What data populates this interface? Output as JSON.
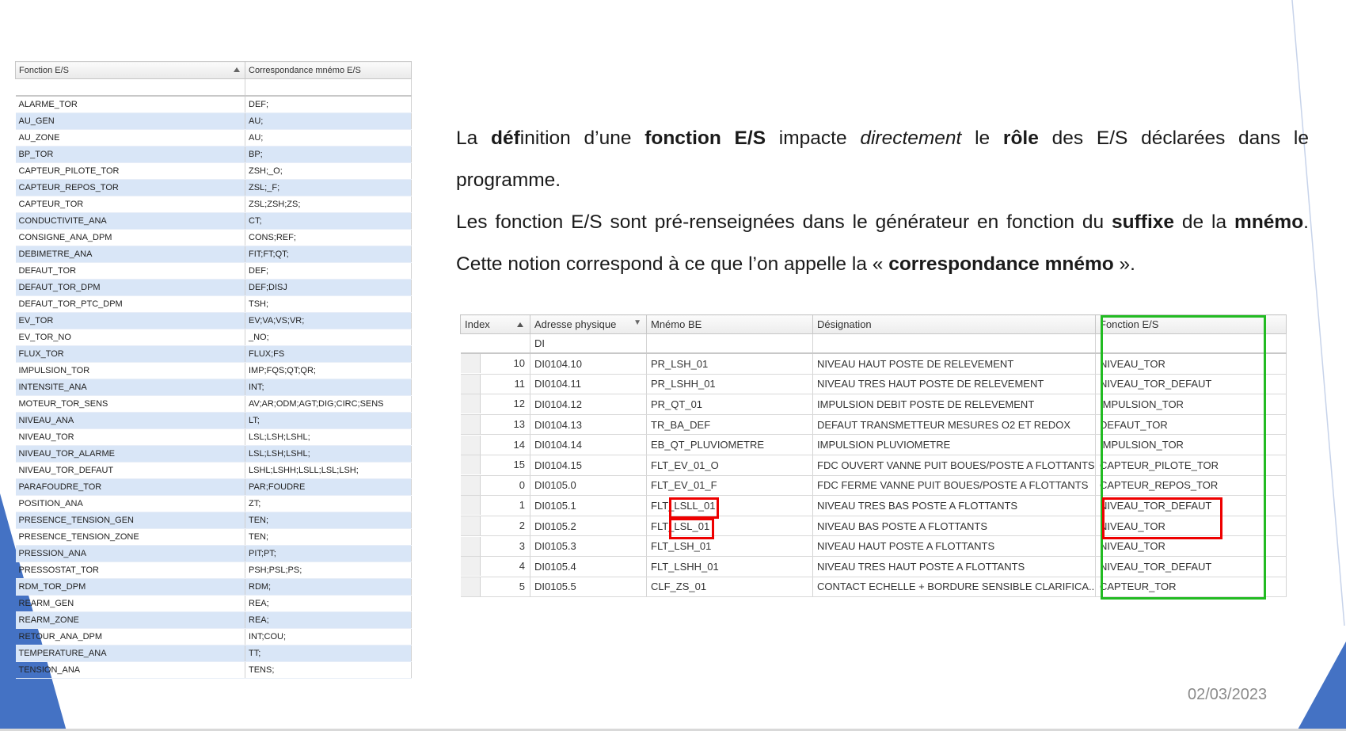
{
  "left_table": {
    "headers": [
      "Fonction E/S",
      "Correspondance mnémo E/S"
    ],
    "rows": [
      [
        "ALARME_TOR",
        "DEF;"
      ],
      [
        "AU_GEN",
        "AU;"
      ],
      [
        "AU_ZONE",
        "AU;"
      ],
      [
        "BP_TOR",
        "BP;"
      ],
      [
        "CAPTEUR_PILOTE_TOR",
        "ZSH;_O;"
      ],
      [
        "CAPTEUR_REPOS_TOR",
        "ZSL;_F;"
      ],
      [
        "CAPTEUR_TOR",
        "ZSL;ZSH;ZS;"
      ],
      [
        "CONDUCTIVITE_ANA",
        "CT;"
      ],
      [
        "CONSIGNE_ANA_DPM",
        "CONS;REF;"
      ],
      [
        "DEBIMETRE_ANA",
        "FIT;FT;QT;"
      ],
      [
        "DEFAUT_TOR",
        "DEF;"
      ],
      [
        "DEFAUT_TOR_DPM",
        "DEF;DISJ"
      ],
      [
        "DEFAUT_TOR_PTC_DPM",
        "TSH;"
      ],
      [
        "EV_TOR",
        "EV;VA;VS;VR;"
      ],
      [
        "EV_TOR_NO",
        "_NO;"
      ],
      [
        "FLUX_TOR",
        "FLUX;FS"
      ],
      [
        "IMPULSION_TOR",
        "IMP;FQS;QT;QR;"
      ],
      [
        "INTENSITE_ANA",
        "INT;"
      ],
      [
        "MOTEUR_TOR_SENS",
        "AV;AR;ODM;AGT;DIG;CIRC;SENS"
      ],
      [
        "NIVEAU_ANA",
        "LT;"
      ],
      [
        "NIVEAU_TOR",
        "LSL;LSH;LSHL;"
      ],
      [
        "NIVEAU_TOR_ALARME",
        "LSL;LSH;LSHL;"
      ],
      [
        "NIVEAU_TOR_DEFAUT",
        "LSHL;LSHH;LSLL;LSL;LSH;"
      ],
      [
        "PARAFOUDRE_TOR",
        "PAR;FOUDRE"
      ],
      [
        "POSITION_ANA",
        "ZT;"
      ],
      [
        "PRESENCE_TENSION_GEN",
        "TEN;"
      ],
      [
        "PRESENCE_TENSION_ZONE",
        "TEN;"
      ],
      [
        "PRESSION_ANA",
        "PIT;PT;"
      ],
      [
        "PRESSOSTAT_TOR",
        "PSH;PSL;PS;"
      ],
      [
        "RDM_TOR_DPM",
        "RDM;"
      ],
      [
        "REARM_GEN",
        "REA;"
      ],
      [
        "REARM_ZONE",
        "REA;"
      ],
      [
        "RETOUR_ANA_DPM",
        "INT;COU;"
      ],
      [
        "TEMPERATURE_ANA",
        "TT;"
      ],
      [
        "TENSION_ANA",
        "TENS;"
      ]
    ]
  },
  "text": {
    "p1": [
      {
        "t": "La ",
        "s": ""
      },
      {
        "t": "déf",
        "s": "b"
      },
      {
        "t": "inition d’une ",
        "s": ""
      },
      {
        "t": "fonction E/S",
        "s": "b"
      },
      {
        "t": " impacte ",
        "s": ""
      },
      {
        "t": "directement",
        "s": "i"
      },
      {
        "t": " le ",
        "s": ""
      },
      {
        "t": "rôle",
        "s": "b"
      },
      {
        "t": " des E/S déclarées dans le programme.",
        "s": ""
      }
    ],
    "p2": [
      {
        "t": "Les fonction E/S sont pré-renseignées dans le générateur en fonction du ",
        "s": ""
      },
      {
        "t": "suffixe",
        "s": "b"
      },
      {
        "t": " de la ",
        "s": ""
      },
      {
        "t": "mnémo",
        "s": "b"
      },
      {
        "t": ". Cette notion correspond à ce que l’on appelle la « ",
        "s": ""
      },
      {
        "t": "correspondance mnémo",
        "s": "b"
      },
      {
        "t": " ».",
        "s": ""
      }
    ]
  },
  "right_table": {
    "headers": [
      "Index",
      "Adresse physique",
      "Mnémo BE",
      "Désignation",
      "Fonction E/S"
    ],
    "filter": [
      "",
      "DI",
      "",
      "",
      ""
    ],
    "rows": [
      [
        "10",
        "DI0104.10",
        "PR_LSH_01",
        "NIVEAU HAUT  POSTE DE RELEVEMENT",
        "NIVEAU_TOR"
      ],
      [
        "11",
        "DI0104.11",
        "PR_LSHH_01",
        "NIVEAU TRES HAUT  POSTE DE RELEVEMENT",
        "NIVEAU_TOR_DEFAUT"
      ],
      [
        "12",
        "DI0104.12",
        "PR_QT_01",
        "IMPULSION DEBIT  POSTE DE RELEVEMENT",
        "IMPULSION_TOR"
      ],
      [
        "13",
        "DI0104.13",
        "TR_BA_DEF",
        "DEFAUT TRANSMETTEUR  MESURES O2 ET REDOX",
        "DEFAUT_TOR"
      ],
      [
        "14",
        "DI0104.14",
        "EB_QT_PLUVIOMETRE",
        "IMPULSION  PLUVIOMETRE",
        "IMPULSION_TOR"
      ],
      [
        "15",
        "DI0104.15",
        "FLT_EV_01_O",
        "FDC OUVERT VANNE PUIT  BOUES/POSTE A FLOTTANTS",
        "CAPTEUR_PILOTE_TOR"
      ],
      [
        "0",
        "DI0105.0",
        "FLT_EV_01_F",
        "FDC FERME VANNE PUIT  BOUES/POSTE A FLOTTANTS",
        "CAPTEUR_REPOS_TOR"
      ],
      [
        "1",
        "DI0105.1",
        "FLT_LSLL_01",
        "NIVEAU TRES BAS  POSTE A FLOTTANTS",
        "NIVEAU_TOR_DEFAUT"
      ],
      [
        "2",
        "DI0105.2",
        "FLT_LSL_01",
        "NIVEAU BAS  POSTE A FLOTTANTS",
        "NIVEAU_TOR"
      ],
      [
        "3",
        "DI0105.3",
        "FLT_LSH_01",
        "NIVEAU HAUT  POSTE A FLOTTANTS",
        "NIVEAU_TOR"
      ],
      [
        "4",
        "DI0105.4",
        "FLT_LSHH_01",
        "NIVEAU TRES HAUT  POSTE A FLOTTANTS",
        "NIVEAU_TOR_DEFAUT"
      ],
      [
        "5",
        "DI0105.5",
        "CLF_ZS_01",
        "CONTACT ECHELLE + BORDURE  SENSIBLE CLARIFICA...",
        "CAPTEUR_TOR"
      ]
    ]
  },
  "date": "02/03/2023",
  "colors": {
    "accent": "#4472c4",
    "highlight_green": "#22bb22",
    "highlight_red": "#e00000",
    "row_alt": "#d9e6f7"
  }
}
